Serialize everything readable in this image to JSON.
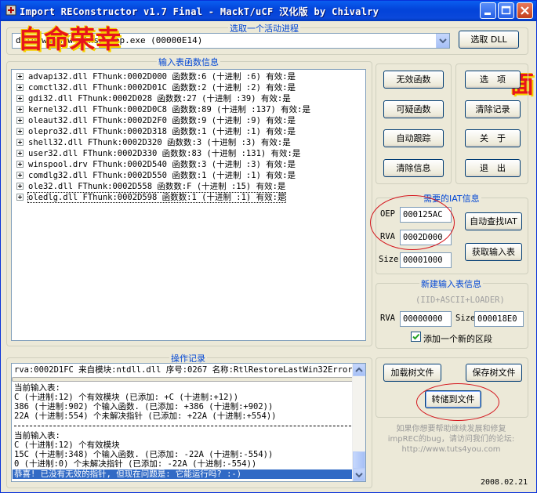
{
  "window": {
    "title": "Import REConstructor v1.7 Final - MackT/uCF 汉化版 by Chivalry"
  },
  "watermark": {
    "left": "自命荣幸",
    "right": "面"
  },
  "process_group": {
    "label": "选取一个活动进程",
    "selected": "d:\\down\\hjw\\vlnsxxapp.exe (00000E14)",
    "pick_dll_label": "选取 DLL"
  },
  "imports_group": {
    "label": "输入表函数信息",
    "items": [
      "advapi32.dll FThunk:0002D000 函数数:6 (十进制 :6) 有效:是",
      "comctl32.dll FThunk:0002D01C 函数数:2 (十进制 :2) 有效:是",
      "gdi32.dll FThunk:0002D028 函数数:27 (十进制 :39) 有效:是",
      "kernel32.dll FThunk:0002D0C8 函数数:89 (十进制 :137) 有效:是",
      "oleaut32.dll FThunk:0002D2F0 函数数:9 (十进制 :9) 有效:是",
      "olepro32.dll FThunk:0002D318 函数数:1 (十进制 :1) 有效:是",
      "shell32.dll FThunk:0002D320 函数数:3 (十进制 :3) 有效:是",
      "user32.dll FThunk:0002D330 函数数:83 (十进制 :131) 有效:是",
      "winspool.drv FThunk:0002D540 函数数:3 (十进制 :3) 有效:是",
      "comdlg32.dll FThunk:0002D550 函数数:1 (十进制 :1) 有效:是",
      "ole32.dll FThunk:0002D558 函数数:F (十进制 :15) 有效:是",
      "oledlg.dll FThunk:0002D598 函数数:1 (十进制 :1) 有效:是"
    ]
  },
  "func_buttons": {
    "invalid": "无效函数",
    "suspect": "可疑函数",
    "auto_trace": "自动跟踪",
    "clear_info": "清除信息"
  },
  "side_buttons": {
    "options": "选　项",
    "clear_log": "清除记录",
    "about": "关　于",
    "exit": "退　出"
  },
  "iat_group": {
    "label": "需要的IAT信息",
    "oep_label": "OEP",
    "oep_value": "000125AC",
    "rva_label": "RVA",
    "rva_value": "0002D000",
    "size_label": "Size",
    "size_value": "00001000",
    "auto_search_label": "自动查找IAT",
    "get_imports_label": "获取输入表"
  },
  "new_import_group": {
    "label": "新建输入表信息",
    "subtitle": "(IID+ASCII+LOADER)",
    "rva_label": "RVA",
    "rva_value": "00000000",
    "size_label": "Size",
    "size_value": "000018E0",
    "add_section_label": "添加一个新的区段"
  },
  "log_group": {
    "label": "操作记录",
    "top_line": "rva:0002D1FC 来自模块:ntdll.dll 序号:0267 名称:RtlRestoreLastWin32Error",
    "block1": [
      "当前输入表:",
      "C (十进制:12) 个有效模块 (已添加: +C (十进制:+12))",
      "386 (十进制:902) 个输入函数. (已添加: +386 (十进制:+902))",
      "22A (十进制:554) 个未解决指针 (已添加: +22A (十进制:+554))"
    ],
    "block2": [
      "当前输入表:",
      "C (十进制:12) 个有效模块",
      "15C (十进制:348) 个输入函数. (已添加: -22A (十进制:-554))",
      "0 (十进制:0) 个未解决指针 (已添加: -22A (十进制:-554))"
    ],
    "highlighted": "恭喜! 已没有无效的指针, 但现在问题是: 它能运行吗? :-)"
  },
  "tree_buttons": {
    "load_tree": "加载树文件",
    "save_tree": "保存树文件",
    "dump_fix": "转储到文件"
  },
  "footer": {
    "line1": "如果你想要帮助继续发展和修复",
    "line2": "impREC的bug，请访问我们的论坛:",
    "line3": "http://www.tuts4you.com",
    "date": "2008.02.21"
  },
  "colors": {
    "accent": "#0046d5",
    "title_bar": "#0343d9",
    "annotation": "#d4151c",
    "selection": "#316ac5"
  }
}
